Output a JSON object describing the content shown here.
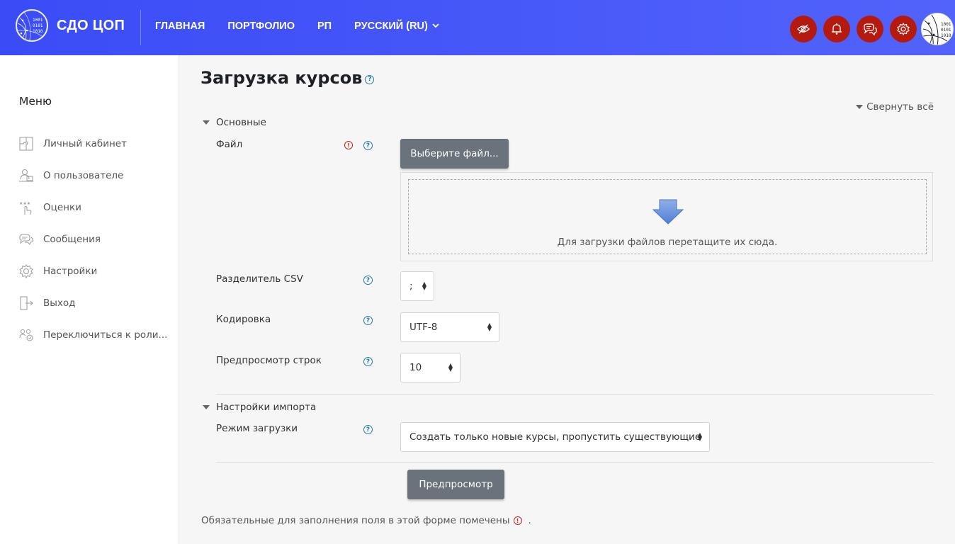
{
  "header": {
    "brand": "СДО ЦОП",
    "logo_bits": [
      "1001",
      "0101",
      "1010"
    ],
    "nav": [
      "ГЛАВНАЯ",
      "ПОРТФОЛИО",
      "РП",
      "РУССКИЙ (RU)"
    ],
    "icons": [
      "eye-slash-icon",
      "bell-icon",
      "chat-icon",
      "gear-icon"
    ],
    "icon_bg": "#b51a0e"
  },
  "sidebar": {
    "title": "Меню",
    "items": [
      {
        "label": "Личный кабинет",
        "icon": "puzzle-icon"
      },
      {
        "label": "О пользователе",
        "icon": "user-desk-icon"
      },
      {
        "label": "Оценки",
        "icon": "stars-hand-icon"
      },
      {
        "label": "Сообщения",
        "icon": "chat-icon"
      },
      {
        "label": "Настройки",
        "icon": "gear-icon"
      },
      {
        "label": "Выход",
        "icon": "exit-door-icon"
      },
      {
        "label": "Переключиться к роли...",
        "icon": "users-switch-icon"
      }
    ]
  },
  "main": {
    "title": "Загрузка курсов",
    "collapse_all": "Свернуть всё",
    "section_general": "Основные",
    "file_label": "Файл",
    "choose_file": "Выберите файл...",
    "drop_message": "Для загрузки файлов перетащите их сюда.",
    "csv_label": "Разделитель CSV",
    "csv_value": ";",
    "encoding_label": "Кодировка",
    "encoding_value": "UTF-8",
    "preview_rows_label": "Предпросмотр строк",
    "preview_rows_value": "10",
    "section_import": "Настройки импорта",
    "mode_label": "Режим загрузки",
    "mode_value": "Создать только новые курсы, пропустить существующие",
    "preview_button": "Предпросмотр",
    "required_note": "Обязательные для заполнения поля в этой форме помечены",
    "required_note_end": "."
  }
}
